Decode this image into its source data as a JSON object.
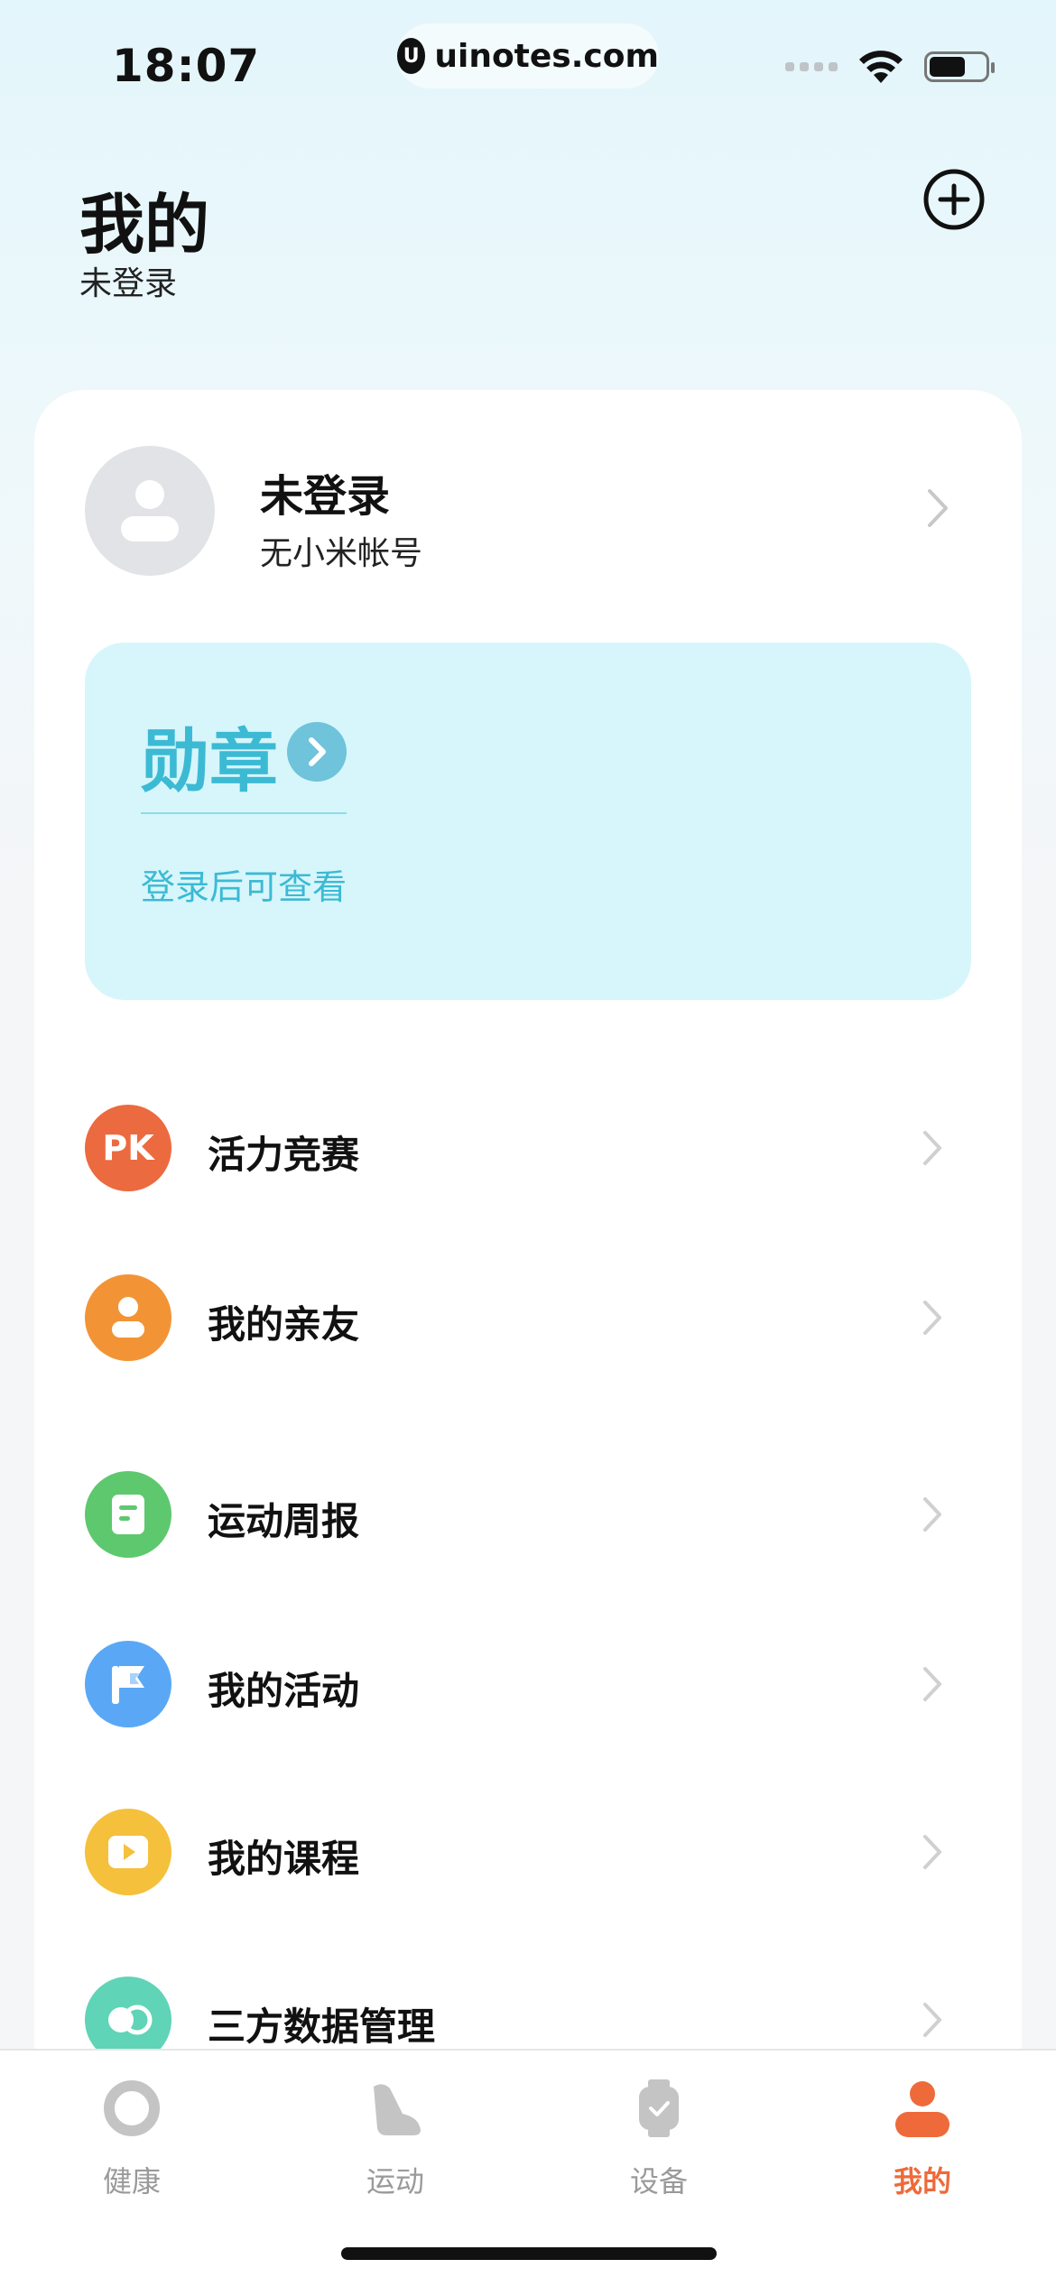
{
  "status_bar": {
    "time": "18:07",
    "url": "uinotes.com",
    "url_logo": "U",
    "battery_level": 0.65
  },
  "header": {
    "title": "我的",
    "subtitle": "未登录",
    "add_icon": "plus-circle-icon"
  },
  "profile": {
    "name": "未登录",
    "account": "无小米帐号"
  },
  "badge_card": {
    "title": "勋章",
    "hint": "登录后可查看",
    "accent_color": "#3cbad4"
  },
  "menu": {
    "items": [
      {
        "label": "活力竞赛",
        "icon": "pk-icon",
        "icon_text": "PK",
        "color": "#ec6a3f"
      },
      {
        "label": "我的亲友",
        "icon": "person-icon",
        "color": "#f29436"
      },
      {
        "label": "运动周报",
        "icon": "report-icon",
        "color": "#5ec86e"
      },
      {
        "label": "我的活动",
        "icon": "flag-icon",
        "color": "#5aa8f5"
      },
      {
        "label": "我的课程",
        "icon": "play-icon",
        "color": "#f5c03c"
      },
      {
        "label": "三方数据管理",
        "icon": "link-icon",
        "color": "#5fd4b6"
      }
    ]
  },
  "tabbar": {
    "tabs": [
      {
        "label": "健康",
        "icon": "ring-icon",
        "active": false
      },
      {
        "label": "运动",
        "icon": "shoe-icon",
        "active": false
      },
      {
        "label": "设备",
        "icon": "watch-icon",
        "active": false
      },
      {
        "label": "我的",
        "icon": "person-icon",
        "active": true
      }
    ],
    "active_color": "#ee6a3a",
    "inactive_color": "#c4c4c4"
  }
}
